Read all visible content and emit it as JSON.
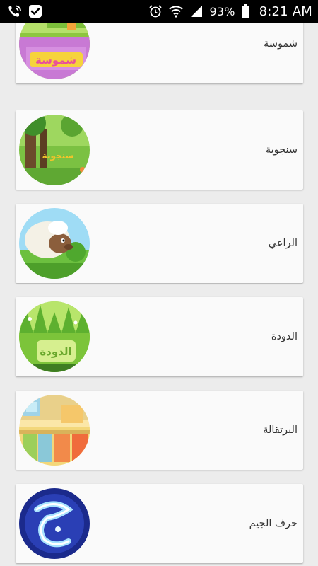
{
  "status_bar": {
    "left_icons": [
      "phone-wifi-icon",
      "checkmark-app-icon"
    ],
    "right_icons": [
      "alarm-icon",
      "wifi-icon",
      "signal-icon",
      "battery-icon"
    ],
    "battery_percent": "93%",
    "time": "8:21 AM"
  },
  "list": {
    "items": [
      {
        "title": "شموسة",
        "thumb_icon": "shamousa-thumbnail"
      },
      {
        "title": "سنجوبة",
        "thumb_icon": "sanjouba-thumbnail"
      },
      {
        "title": "الراعي",
        "thumb_icon": "shepherd-thumbnail"
      },
      {
        "title": "الدودة",
        "thumb_icon": "worm-thumbnail"
      },
      {
        "title": "البرتقالة",
        "thumb_icon": "orange-thumbnail"
      },
      {
        "title": "حرف الجيم",
        "thumb_icon": "letter-jeem-thumbnail"
      }
    ]
  }
}
